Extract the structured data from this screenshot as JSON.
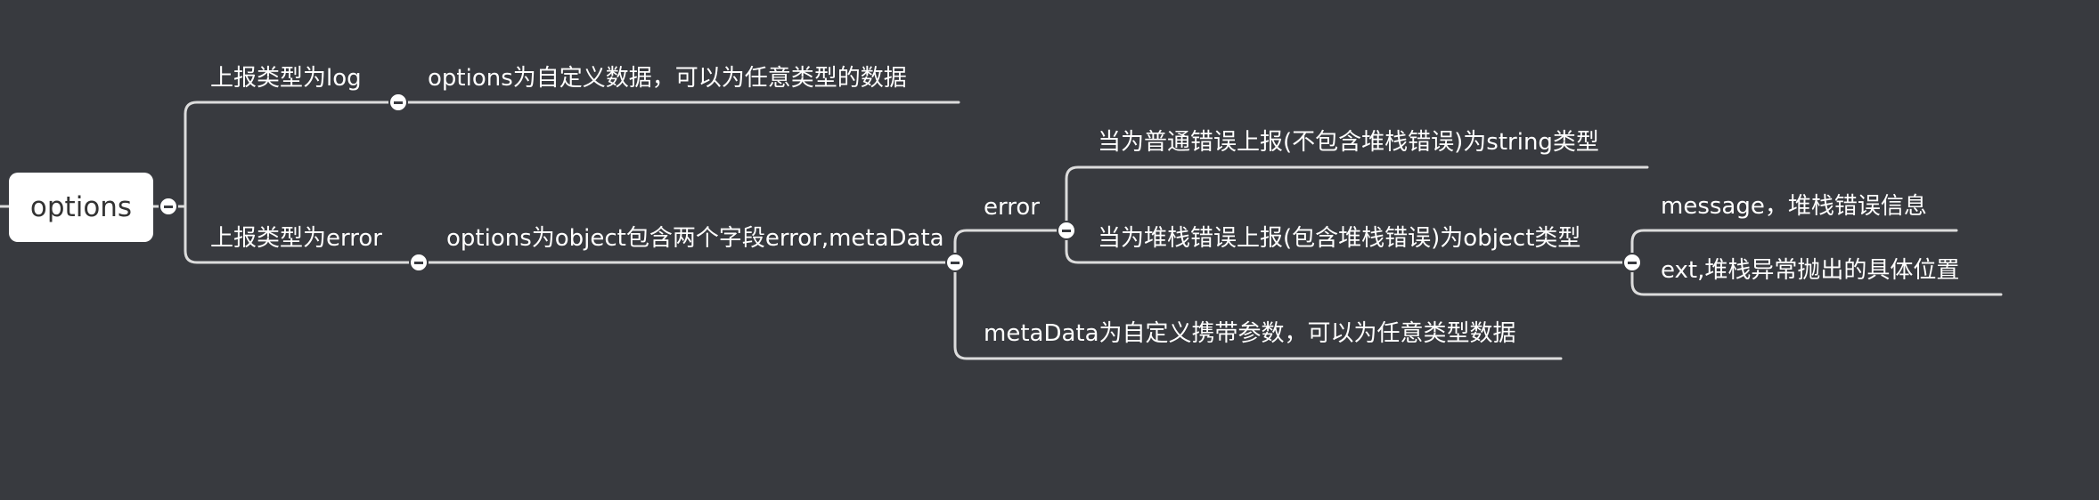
{
  "root": {
    "label": "options"
  },
  "branches": {
    "log": {
      "label": "上报类型为log",
      "child": "options为自定义数据，可以为任意类型的数据"
    },
    "error": {
      "label": "上报类型为error",
      "child": "options为object包含两个字段error,metaData",
      "error_node": {
        "label": "error",
        "string_case": "当为普通错误上报(不包含堆栈错误)为string类型",
        "object_case": "当为堆栈错误上报(包含堆栈错误)为object类型",
        "object_fields": {
          "message": "message，堆栈错误信息",
          "ext": "ext,堆栈异常抛出的具体位置"
        }
      },
      "metadata_node": {
        "label": "metaData为自定义携带参数，可以为任意类型数据"
      }
    }
  },
  "colors": {
    "background": "#383a3f",
    "line": "#dcdcdc",
    "text": "#ffffff",
    "root_fill": "#ffffff",
    "root_text": "#333333"
  }
}
